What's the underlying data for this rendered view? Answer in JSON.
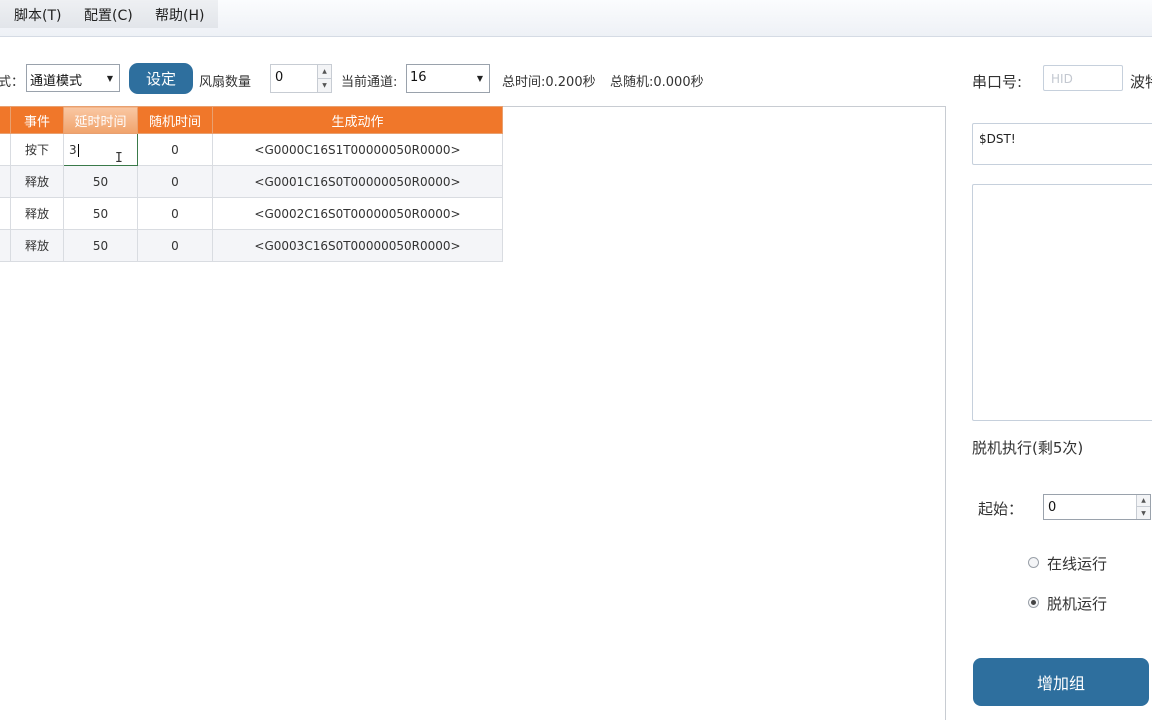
{
  "menu": [
    "脚本(T)",
    "配置(C)",
    "帮助(H)"
  ],
  "toolbar": {
    "mode_label": "式：",
    "mode_value": "通道模式",
    "set_button": "设定",
    "fan_label": "风扇数量",
    "fan_value": "0",
    "channel_label": "当前通道:",
    "channel_value": "16",
    "total_time": "总时间:0.200秒",
    "total_random": "总随机:0.000秒"
  },
  "grid": {
    "headers": [
      "事件",
      "延时时间",
      "随机时间",
      "生成动作"
    ],
    "rows": [
      {
        "event": "按下",
        "delay": "3",
        "random": "0",
        "action": "<G0000C16S1T00000050R0000>"
      },
      {
        "event": "释放",
        "delay": "50",
        "random": "0",
        "action": "<G0001C16S0T00000050R0000>"
      },
      {
        "event": "释放",
        "delay": "50",
        "random": "0",
        "action": "<G0002C16S0T00000050R0000>"
      },
      {
        "event": "释放",
        "delay": "50",
        "random": "0",
        "action": "<G0003C16S0T00000050R0000>"
      }
    ]
  },
  "right": {
    "port_label": "串口号:",
    "port_placeholder": "HID",
    "baud_label": "波特",
    "command_text": "$DST!",
    "offline_label": "脱机执行(剩5次)",
    "start_label": "起始：",
    "start_value": "0",
    "radio_online": "在线运行",
    "radio_offline": "脱机运行",
    "add_group_button": "增加组"
  },
  "colors": {
    "header_orange": "#f0772a",
    "button_blue": "#2e6f9e"
  }
}
